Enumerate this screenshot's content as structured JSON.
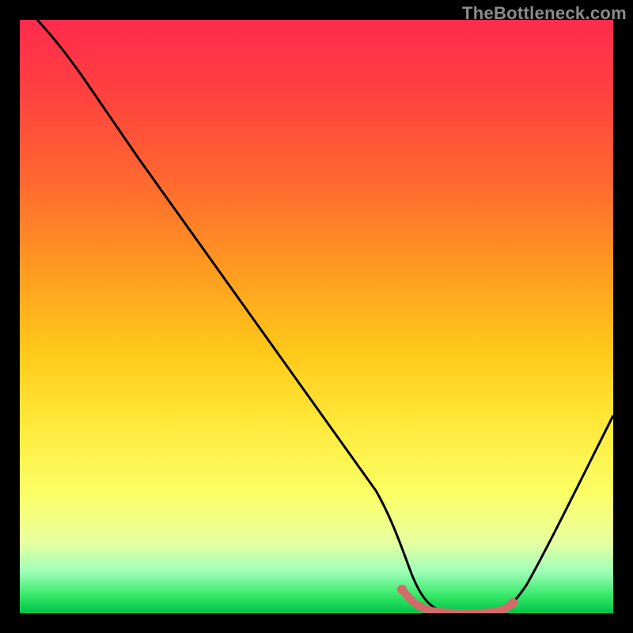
{
  "watermark": "TheBottleneck.com",
  "chart_data": {
    "type": "line",
    "title": "",
    "xlabel": "",
    "ylabel": "",
    "xlim": [
      0,
      100
    ],
    "ylim": [
      0,
      100
    ],
    "gradient_stops": [
      {
        "pct": 0,
        "color": "#ff2b4d"
      },
      {
        "pct": 12,
        "color": "#ff4040"
      },
      {
        "pct": 28,
        "color": "#ff6a2f"
      },
      {
        "pct": 42,
        "color": "#ff9a20"
      },
      {
        "pct": 56,
        "color": "#ffc91a"
      },
      {
        "pct": 68,
        "color": "#ffe93a"
      },
      {
        "pct": 80,
        "color": "#fbff66"
      },
      {
        "pct": 88,
        "color": "#e8ffa0"
      },
      {
        "pct": 93,
        "color": "#9dffb8"
      },
      {
        "pct": 97,
        "color": "#35e868"
      },
      {
        "pct": 100,
        "color": "#00c247"
      }
    ],
    "series": [
      {
        "name": "curve",
        "color": "#000000",
        "x": [
          3,
          6,
          10,
          20,
          30,
          40,
          50,
          60,
          64,
          68,
          72,
          76,
          80,
          82,
          86,
          90,
          94,
          100
        ],
        "y": [
          100,
          97,
          93,
          79,
          65,
          51,
          37,
          22,
          15,
          8,
          3,
          1,
          0,
          0,
          1,
          5,
          12,
          27
        ]
      }
    ],
    "highlight": {
      "name": "optimal-range",
      "color": "#d46a6a",
      "x": [
        64,
        68,
        72,
        76,
        80,
        82
      ],
      "y": [
        4,
        2,
        1,
        0.5,
        0.5,
        1.5
      ]
    }
  }
}
